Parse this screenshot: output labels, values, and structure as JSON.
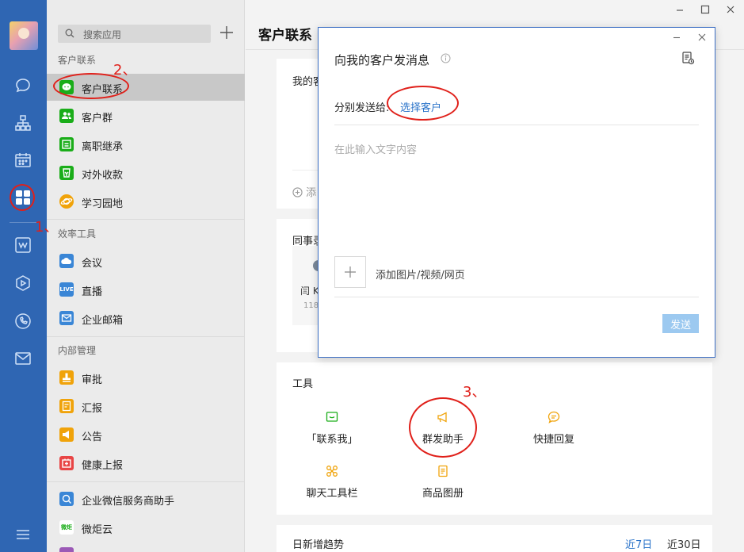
{
  "colors": {
    "rail": "#2f66b3",
    "accent": "#2a73c9",
    "annotation": "#e0201a",
    "green": "#1aad19",
    "orange": "#f0a30a",
    "red": "#e84545",
    "blue": "#3a86d6"
  },
  "sidebar": {
    "search_placeholder": "搜索应用",
    "section_customer": "客户联系",
    "section_efficiency": "效率工具",
    "section_internal": "内部管理",
    "items": [
      {
        "label": "客户联系",
        "icon": "wechat-icon"
      },
      {
        "label": "客户群",
        "icon": "group-icon"
      },
      {
        "label": "离职继承",
        "icon": "inherit-icon"
      },
      {
        "label": "对外收款",
        "icon": "payment-icon"
      },
      {
        "label": "学习园地",
        "icon": "planet-icon"
      },
      {
        "label": "会议",
        "icon": "cloud-icon"
      },
      {
        "label": "直播",
        "icon": "live-icon"
      },
      {
        "label": "企业邮箱",
        "icon": "mail-icon"
      },
      {
        "label": "审批",
        "icon": "stamp-icon"
      },
      {
        "label": "汇报",
        "icon": "report-icon"
      },
      {
        "label": "公告",
        "icon": "announce-icon"
      },
      {
        "label": "健康上报",
        "icon": "health-icon"
      },
      {
        "label": "企业微信服务商助手",
        "icon": "helper-icon"
      },
      {
        "label": "微炬云",
        "icon": "weiju-icon"
      }
    ],
    "live_badge": "LIVE",
    "weiju_badge": "微炬"
  },
  "main": {
    "title": "客户联系",
    "card1_title": "我的客",
    "card1_add": "添",
    "card2_title": "同事录",
    "colleague_name": "闫 K",
    "colleague_num": "118",
    "tools_title": "工具",
    "tools": [
      {
        "label": "「联系我」",
        "icon": "contact-me-icon"
      },
      {
        "label": "群发助手",
        "icon": "megaphone-icon"
      },
      {
        "label": "快捷回复",
        "icon": "quick-reply-icon"
      },
      {
        "label": "聊天工具栏",
        "icon": "chat-toolbar-icon"
      },
      {
        "label": "商品图册",
        "icon": "catalog-icon"
      }
    ],
    "trend_title": "日新增趋势",
    "trend_tab_7": "近7日",
    "trend_tab_30": "近30日"
  },
  "dialog": {
    "title": "向我的客户发消息",
    "recipient_label": "分别发送给:",
    "select_customer": "选择客户",
    "text_placeholder": "在此输入文字内容",
    "add_media": "添加图片/视频/网页",
    "send": "发送"
  },
  "annotations": {
    "n1": "1、",
    "n2": "2、",
    "n3": "3、"
  }
}
